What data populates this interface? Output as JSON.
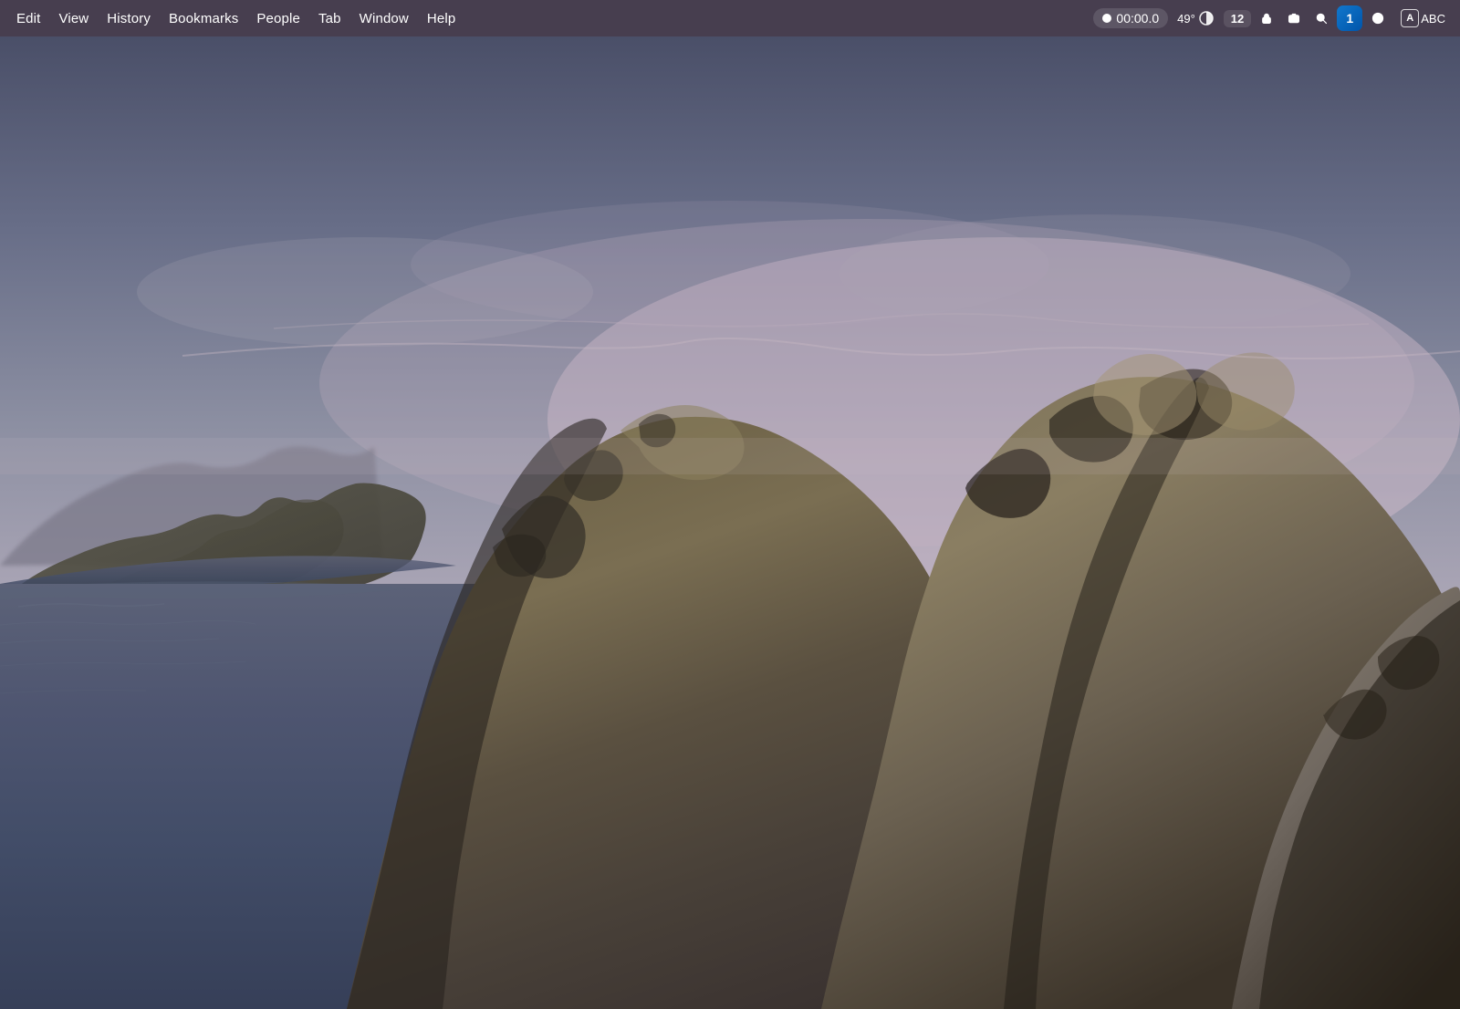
{
  "menubar": {
    "items": [
      {
        "id": "edit",
        "label": "Edit"
      },
      {
        "id": "view",
        "label": "View"
      },
      {
        "id": "history",
        "label": "History"
      },
      {
        "id": "bookmarks",
        "label": "Bookmarks"
      },
      {
        "id": "people",
        "label": "People"
      },
      {
        "id": "tab",
        "label": "Tab"
      },
      {
        "id": "window",
        "label": "Window"
      },
      {
        "id": "help",
        "label": "Help"
      }
    ],
    "status": {
      "recording_time": "00:00.0",
      "temperature": "49°",
      "badge_count": "12"
    }
  },
  "desktop": {
    "wallpaper_description": "macOS Catalina - coastal cliffs at dusk with ocean"
  }
}
